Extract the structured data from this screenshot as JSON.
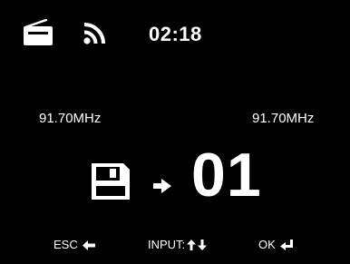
{
  "status_bar": {
    "mode_icon": "radio-icon",
    "signal_icon": "wifi-signal-icon",
    "time": "02:18"
  },
  "frequencies": {
    "left": "91.70MHz",
    "right": "91.70MHz"
  },
  "preset": {
    "save_icon": "floppy-disk-icon",
    "arrow_icon": "arrow-right-icon",
    "number": "01"
  },
  "hints": {
    "esc_label": "ESC",
    "esc_icon": "arrow-left-icon",
    "input_label": "INPUT:",
    "input_icons": [
      "arrow-up-icon",
      "arrow-down-icon"
    ],
    "ok_label": "OK",
    "ok_icon": "return-enter-icon"
  },
  "colors": {
    "background": "#000000",
    "foreground": "#ffffff"
  }
}
